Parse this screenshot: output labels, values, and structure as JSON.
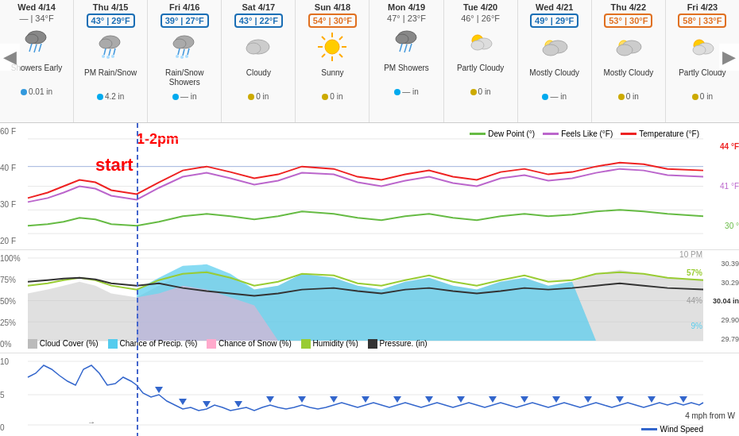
{
  "nav": {
    "left_arrow": "◀",
    "right_arrow": "▶"
  },
  "days": [
    {
      "name": "Wed 4/14",
      "temps": "— | 34°F",
      "badge_color": "none",
      "icon": "🌧️",
      "condition": "Showers Early",
      "precip_type": "blue",
      "precip_amount": "0.01 in"
    },
    {
      "name": "Thu 4/15",
      "temps": "43° | 29°F",
      "badge_color": "blue",
      "icon": "🌧❄️",
      "condition": "PM Rain/Snow",
      "precip_type": "cyan",
      "precip_amount": "4.2 in"
    },
    {
      "name": "Fri 4/16",
      "temps": "39° | 27°F",
      "badge_color": "blue",
      "icon": "🌧❄️",
      "condition": "Rain/Snow Showers",
      "precip_type": "cyan",
      "precip_amount": "— in"
    },
    {
      "name": "Sat 4/17",
      "temps": "43° | 22°F",
      "badge_color": "blue",
      "icon": "☁️",
      "condition": "Cloudy",
      "precip_type": "yellow",
      "precip_amount": "0 in"
    },
    {
      "name": "Sun 4/18",
      "temps": "54° | 30°F",
      "badge_color": "orange",
      "icon": "☀️",
      "condition": "Sunny",
      "precip_type": "yellow",
      "precip_amount": "0 in"
    },
    {
      "name": "Mon 4/19",
      "temps": "47° | 23°F",
      "badge_color": "none",
      "icon": "🌦️",
      "condition": "PM Showers",
      "precip_type": "cyan",
      "precip_amount": "— in"
    },
    {
      "name": "Tue 4/20",
      "temps": "46° | 26°F",
      "badge_color": "none",
      "icon": "⛅",
      "condition": "Partly Cloudy",
      "precip_type": "yellow",
      "precip_amount": "0 in"
    },
    {
      "name": "Wed 4/21",
      "temps": "49° | 29°F",
      "badge_color": "blue",
      "icon": "🌥️",
      "condition": "Mostly Cloudy",
      "precip_type": "cyan",
      "precip_amount": "— in"
    },
    {
      "name": "Thu 4/22",
      "temps": "53° | 30°F",
      "badge_color": "orange",
      "icon": "🌥️",
      "condition": "Mostly Cloudy",
      "precip_type": "yellow",
      "precip_amount": "0 in"
    },
    {
      "name": "Fri 4/23",
      "temps": "58° | 33°F",
      "badge_color": "orange",
      "icon": "⛅",
      "condition": "Partly Cloudy",
      "precip_type": "yellow",
      "precip_amount": "0 in"
    }
  ],
  "annotations": {
    "time": "1-2pm",
    "label": "start"
  },
  "temp_chart": {
    "y_labels_left": [
      "60 F",
      "40 F",
      "30 F",
      "20 F"
    ],
    "y_labels_right": [
      "44 °F",
      "41 °F",
      "30 °"
    ],
    "legend": [
      {
        "label": "Dew Point (°)",
        "color": "#66bb44"
      },
      {
        "label": "Feels Like (°F)",
        "color": "#bb66cc"
      },
      {
        "label": "Temperature (°F)",
        "color": "#ee2222"
      }
    ]
  },
  "cloud_chart": {
    "y_labels": [
      "100%",
      "75%",
      "50%",
      "25%",
      "0%"
    ],
    "y_labels_right": [
      "30.39",
      "30.29",
      "30.04 in",
      "29.90",
      "29.79"
    ],
    "time_label": "10 PM",
    "legend": [
      {
        "label": "Cloud Cover (%)",
        "color": "#bbbbbb"
      },
      {
        "label": "Chance of Precip. (%)",
        "color": "#55ccee"
      },
      {
        "label": "Chance of Snow (%)",
        "color": "#ffaacc"
      },
      {
        "label": "Humidity (%)",
        "color": "#99cc33"
      },
      {
        "label": "Pressure. (in)",
        "color": "#333333"
      }
    ]
  },
  "wind_chart": {
    "y_labels": [
      "10",
      "5",
      "0"
    ],
    "wind_label": "4 mph from W",
    "legend_label": "Wind Speed",
    "legend_color": "#3366cc"
  }
}
